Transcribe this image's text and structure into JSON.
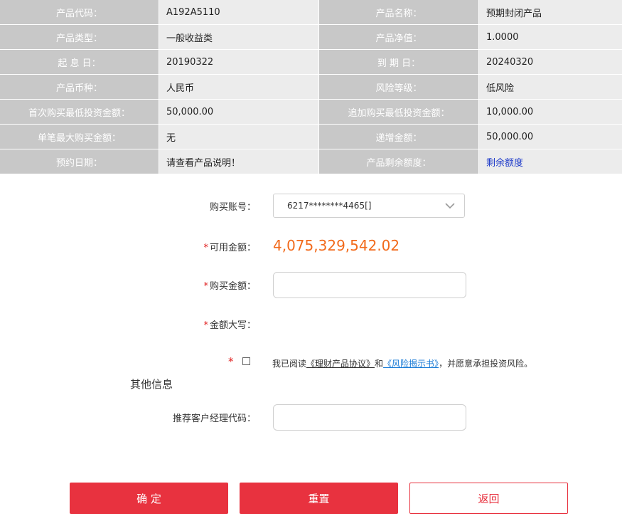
{
  "info": {
    "rows": [
      {
        "l1": "产品代码：",
        "v1": "A192A5110",
        "l2": "产品名称：",
        "v2": "预期封闭产品"
      },
      {
        "l1": "产品类型：",
        "v1": "一般收益类",
        "l2": "产品净值：",
        "v2": "1.0000"
      },
      {
        "l1": "起 息 日：",
        "v1": "20190322",
        "l2": "到 期 日：",
        "v2": "20240320"
      },
      {
        "l1": "产品币种：",
        "v1": "人民币",
        "l2": "风险等级：",
        "v2": "低风险"
      },
      {
        "l1": "首次购买最低投资金额：",
        "v1": "50,000.00",
        "l2": "追加购买最低投资金额：",
        "v2": "10,000.00"
      },
      {
        "l1": "单笔最大购买金额：",
        "v1": "无",
        "l2": "递增金额：",
        "v2": "50,000.00"
      },
      {
        "l1": "预约日期：",
        "v1": " 请查看产品说明！",
        "l2": "产品剩余额度：",
        "v2": "剩余额度"
      }
    ]
  },
  "form": {
    "account_label": "购买账号：",
    "account_value": "6217********4465[]",
    "available_label": "可用金额：",
    "available_value": "4,075,329,542.02",
    "purchase_label": "购买金额：",
    "purchase_value": "",
    "uppercase_label": "金额大写：",
    "required_mark": "*",
    "agree_prefix": "我已阅读",
    "agree_link1": "《理财产品协议》",
    "agree_mid": "和",
    "agree_link2": "《风险揭示书》",
    "agree_suffix": "，并愿意承担投资风险。",
    "other_section": "其他信息",
    "manager_label": "推荐客户经理代码：",
    "manager_value": ""
  },
  "buttons": {
    "confirm": "确 定",
    "reset": "重置",
    "back": "返回"
  },
  "colors": {
    "accent": "#e8323f",
    "amount": "#f26a1b",
    "link": "#1a7bd6",
    "label_bg": "#c8c8c8",
    "value_bg": "#ececec"
  },
  "icons": {
    "select_arrow": "chevron-down-icon"
  }
}
